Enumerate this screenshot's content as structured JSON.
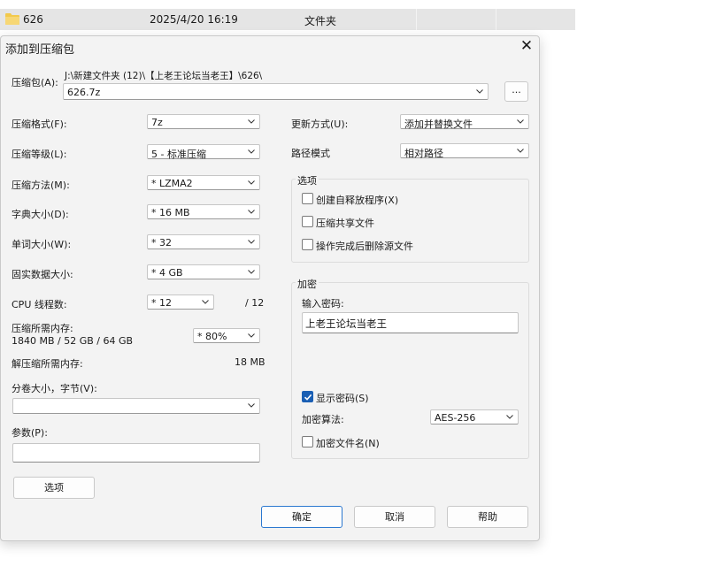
{
  "explorer_row": {
    "name": "626",
    "date": "2025/4/20 16:19",
    "type": "文件夹"
  },
  "dialog": {
    "title": "添加到压缩包",
    "archive_label": "压缩包(A):",
    "archive_path": "J:\\新建文件夹 (12)\\【上老王论坛当老王】\\626\\",
    "archive_name": "626.7z",
    "browse_label": "...",
    "left": {
      "format_label": "压缩格式(F):",
      "format_value": "7z",
      "level_label": "压缩等级(L):",
      "level_value": "5 - 标准压缩",
      "method_label": "压缩方法(M):",
      "method_value": "*  LZMA2",
      "dict_label": "字典大小(D):",
      "dict_value": "*  16 MB",
      "word_label": "单词大小(W):",
      "word_value": "*  32",
      "solid_label": "固实数据大小:",
      "solid_value": "* 4 GB",
      "threads_label": "CPU 线程数:",
      "threads_value": "*  12",
      "threads_total": "/ 12",
      "mem_label": "压缩所需内存:",
      "mem_detail": "1840 MB / 52 GB / 64 GB",
      "mem_value": "* 80%",
      "decomp_label": "解压缩所需内存:",
      "decomp_value": "18 MB",
      "split_label": "分卷大小，字节(V):",
      "split_value": "",
      "params_label": "参数(P):",
      "params_value": "",
      "options_button": "选项"
    },
    "right": {
      "update_label": "更新方式(U):",
      "update_value": "添加并替换文件",
      "path_label": "路径模式",
      "path_value": "相对路径",
      "options_group": "选项",
      "opt_sfx": "创建自释放程序(X)",
      "opt_shared": "压缩共享文件",
      "opt_delete": "操作完成后删除源文件",
      "encryption_group": "加密",
      "password_label": "输入密码:",
      "password_value": "上老王论坛当老王",
      "show_password": "显示密码(S)",
      "enc_method_label": "加密算法:",
      "enc_method_value": "AES-256",
      "encrypt_names": "加密文件名(N)"
    },
    "buttons": {
      "ok": "确定",
      "cancel": "取消",
      "help": "帮助"
    }
  },
  "colors": {
    "accent": "#1a5fb4",
    "dialog_bg": "#f3f3f3",
    "folder": "#f2c94c"
  }
}
